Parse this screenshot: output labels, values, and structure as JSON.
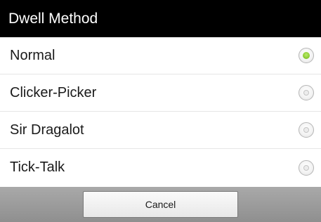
{
  "dialog": {
    "title": "Dwell Method",
    "options": [
      {
        "label": "Normal",
        "selected": true
      },
      {
        "label": "Clicker-Picker",
        "selected": false
      },
      {
        "label": "Sir Dragalot",
        "selected": false
      },
      {
        "label": "Tick-Talk",
        "selected": false
      }
    ],
    "cancel_label": "Cancel"
  },
  "colors": {
    "title_bar_bg": "#000000",
    "selected_radio": "#8dcc34",
    "button_bar_bg": "#9a9a9a"
  },
  "icons": {
    "option_indicator": "radio-button-icon"
  }
}
